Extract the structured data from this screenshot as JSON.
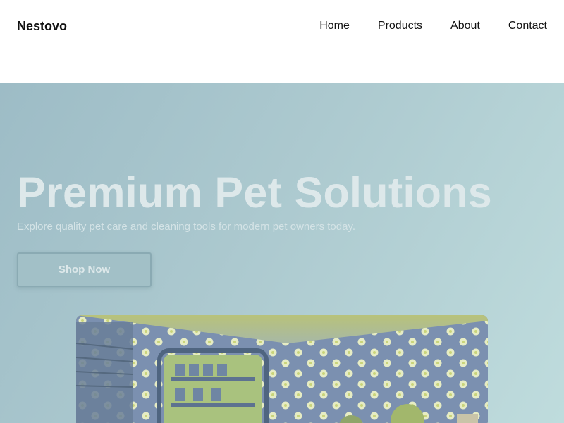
{
  "header": {
    "logo": "Nestovo",
    "nav": [
      "Home",
      "Products",
      "About",
      "Contact"
    ]
  },
  "hero": {
    "title": "Premium Pet Solutions",
    "subtitle": "Explore quality pet care and cleaning tools for modern pet owners today.",
    "cta_label": "Shop Now"
  },
  "colors": {
    "hero_gradient_start": "#9dbcc6",
    "hero_gradient_end": "#bfdcdd",
    "title_text": "#dde8ea",
    "photo_wall": "#7f93b0",
    "photo_flower": "#e6ecc4"
  }
}
